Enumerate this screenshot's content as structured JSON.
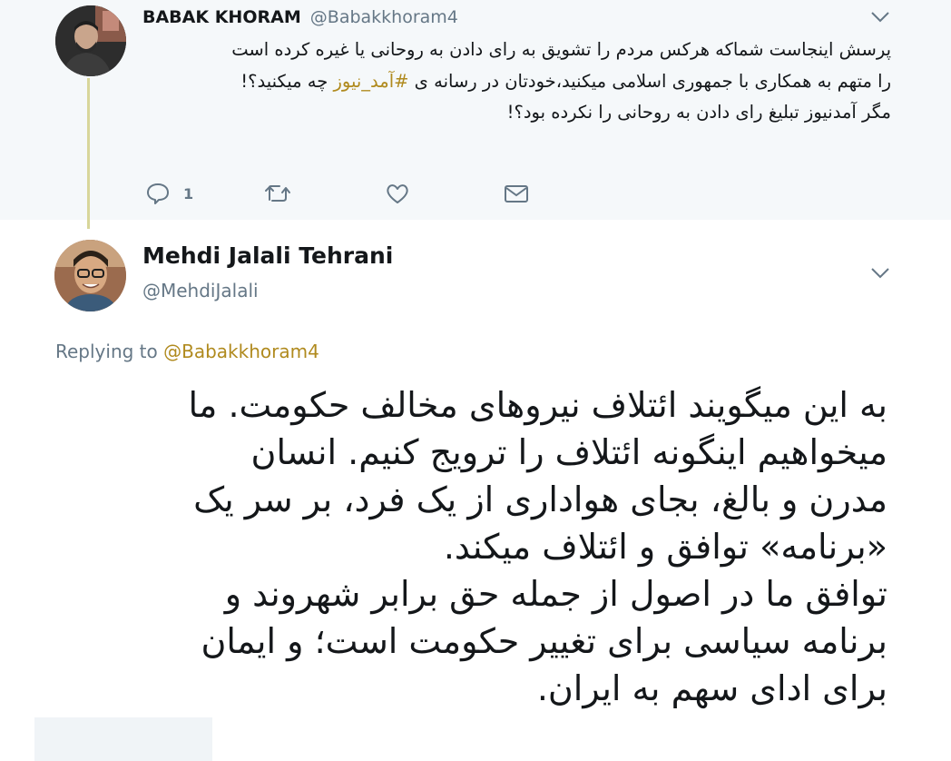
{
  "parent_tweet": {
    "author_name": "BABAK KHORAM",
    "author_handle": "@Babakkhoram4",
    "text_line_1": "پرسش اینجاست شماکه هرکس مردم را تشویق به رای دادن به روحانی یا غیره کرده است",
    "text_line_2_before": "را متهم به همکاری با جمهوری اسلامی میکنید،خودتان در رسانه ی ",
    "text_line_2_hashtag": "#آمد_نیوز",
    "text_line_2_after": " چه میکنید؟!",
    "text_line_3": "مگر آمدنیوز تبلیغ رای دادن به روحانی را نکرده بود؟!",
    "reply_count": "1",
    "icons": {
      "reply": "reply-icon",
      "retweet": "retweet-icon",
      "like": "heart-icon",
      "message": "envelope-icon",
      "menu": "chevron-down-icon"
    }
  },
  "main_tweet": {
    "author_name": "Mehdi Jalali Tehrani",
    "author_handle": "@MehdiJalali",
    "replying_prefix": "Replying to ",
    "replying_to": "@Babakkhoram4",
    "lines": [
      "به این میگویند ائتلاف نیروهای مخالف حکومت. ما",
      "میخواهیم اینگونه ائتلاف را ترویج کنیم. انسان",
      "مدرن و بالغ، بجای هواداری از یک فرد، بر سر یک",
      "«برنامه» توافق و ائتلاف میکند.",
      "توافق ما در اصول از جمله حق برابر شهروند و",
      "برنامه سیاسی برای تغییر حکومت است؛ و ایمان",
      "برای ادای سهم به ایران."
    ]
  },
  "colors": {
    "parent_background": "#f5f8fa",
    "thread_line": "#d8d69a",
    "link_accent": "#b08a1e",
    "secondary_text": "#657786",
    "primary_text": "#14171a"
  }
}
